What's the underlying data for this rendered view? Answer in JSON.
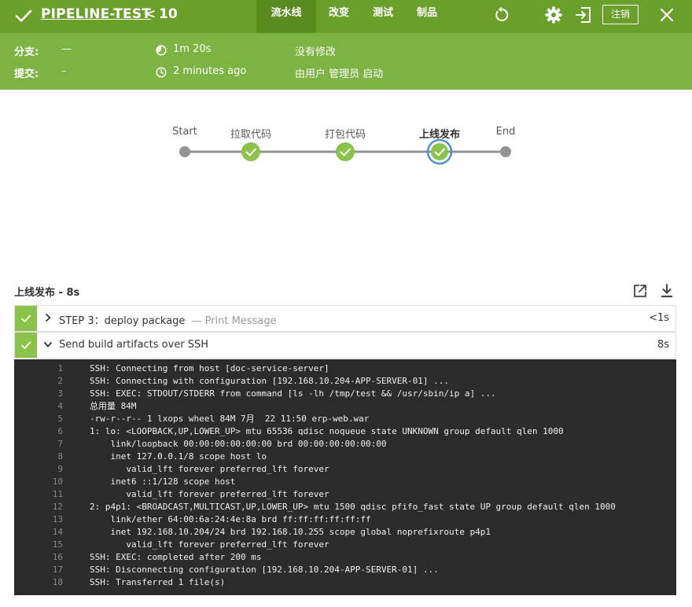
{
  "header": {
    "title": "PIPELINE-TEST",
    "chevron": "<",
    "run_number": "10",
    "tabs": [
      {
        "label": "流水线",
        "active": true
      },
      {
        "label": "改变",
        "active": false
      },
      {
        "label": "测试",
        "active": false
      },
      {
        "label": "制品",
        "active": false
      }
    ],
    "logout_label": "注销",
    "colors": {
      "bar": "#6b9f2b",
      "info": "#7cb342",
      "success": "#8bc34a",
      "active_ring": "#4a90d9"
    }
  },
  "info": {
    "branch_label": "分支:",
    "branch_value": "—",
    "commit_label": "提交:",
    "commit_value": "–",
    "duration": "1m 20s",
    "time_ago": "2 minutes ago",
    "changes": "没有修改",
    "started_by": "由用户 管理员 启动"
  },
  "pipeline": {
    "stages": [
      {
        "label": "Start",
        "status": "node"
      },
      {
        "label": "拉取代码",
        "status": "success"
      },
      {
        "label": "打包代码",
        "status": "success"
      },
      {
        "label": "上线发布",
        "status": "success-selected"
      },
      {
        "label": "End",
        "status": "node"
      }
    ]
  },
  "panel": {
    "title": "上线发布 - 8s",
    "steps": [
      {
        "name": "STEP 3：deploy package",
        "sub": "— Print Message",
        "duration": "<1s",
        "expanded": false
      },
      {
        "name": "Send build artifacts over SSH",
        "sub": "",
        "duration": "8s",
        "expanded": true
      }
    ]
  },
  "console": {
    "lines": [
      {
        "n": "1",
        "t": "SSH: Connecting from host [doc-service-server]"
      },
      {
        "n": "2",
        "t": "SSH: Connecting with configuration [192.168.10.204-APP-SERVER-01] ..."
      },
      {
        "n": "3",
        "t": "SSH: EXEC: STDOUT/STDERR from command [ls -lh /tmp/test && /usr/sbin/ip a] ..."
      },
      {
        "n": "4",
        "t": "总用量 84M"
      },
      {
        "n": "5",
        "t": "-rw-r--r-- 1 lxops wheel 84M 7月  22 11:50 erp-web.war"
      },
      {
        "n": "6",
        "t": "1: lo: <LOOPBACK,UP,LOWER_UP> mtu 65536 qdisc noqueue state UNKNOWN group default qlen 1000"
      },
      {
        "n": "7",
        "t": "    link/loopback 00:00:00:00:00:00 brd 00:00:00:00:00:00"
      },
      {
        "n": "8",
        "t": "    inet 127.0.0.1/8 scope host lo"
      },
      {
        "n": "9",
        "t": "       valid_lft forever preferred_lft forever"
      },
      {
        "n": "10",
        "t": "    inet6 ::1/128 scope host"
      },
      {
        "n": "11",
        "t": "       valid_lft forever preferred_lft forever"
      },
      {
        "n": "12",
        "t": "2: p4p1: <BROADCAST,MULTICAST,UP,LOWER_UP> mtu 1500 qdisc pfifo_fast state UP group default qlen 1000"
      },
      {
        "n": "13",
        "t": "    link/ether 64:00:6a:24:4e:8a brd ff:ff:ff:ff:ff:ff"
      },
      {
        "n": "14",
        "t": "    inet 192.168.10.204/24 brd 192.168.10.255 scope global noprefixroute p4p1"
      },
      {
        "n": "15",
        "t": "       valid_lft forever preferred_lft forever"
      },
      {
        "n": "16",
        "t": "SSH: EXEC: completed after 200 ms"
      },
      {
        "n": "17",
        "t": "SSH: Disconnecting configuration [192.168.10.204-APP-SERVER-01] ..."
      },
      {
        "n": "18",
        "t": "SSH: Transferred 1 file(s)"
      }
    ]
  }
}
